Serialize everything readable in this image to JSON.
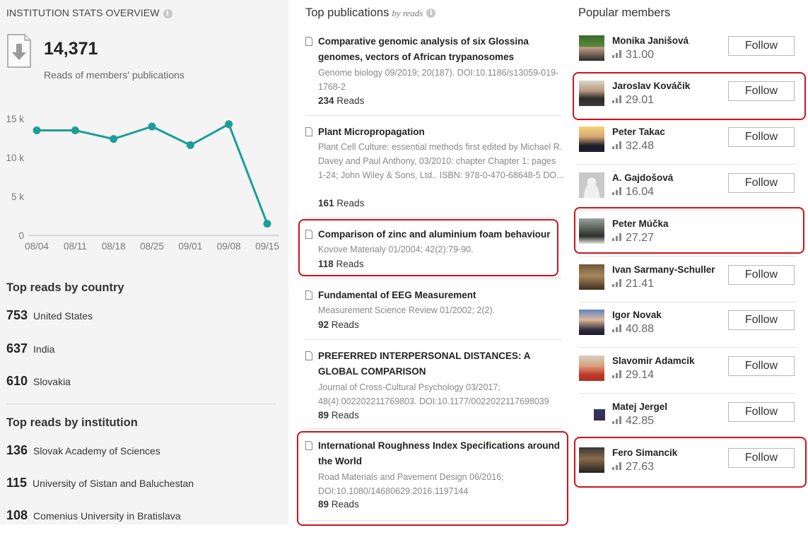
{
  "stats": {
    "title": "INSTITUTION STATS OVERVIEW",
    "info_icon": "info-icon",
    "total_reads": "14,371",
    "reads_caption": "Reads of members' publications"
  },
  "chart_data": {
    "type": "line",
    "categories": [
      "08/04",
      "08/11",
      "08/18",
      "08/25",
      "09/01",
      "09/08",
      "09/15"
    ],
    "values": [
      13500,
      13500,
      12400,
      14000,
      11600,
      14300,
      1500
    ],
    "y_ticks": [
      "0",
      "5 k",
      "10 k",
      "15 k"
    ],
    "ylim": [
      0,
      15000
    ],
    "color": "#1a9e98",
    "grid": false
  },
  "countries": {
    "title": "Top reads by country",
    "items": [
      {
        "count": "753",
        "label": "United States"
      },
      {
        "count": "637",
        "label": "India"
      },
      {
        "count": "610",
        "label": "Slovakia"
      }
    ]
  },
  "institutions": {
    "title": "Top reads by institution",
    "items": [
      {
        "count": "136",
        "label": "Slovak Academy of Sciences"
      },
      {
        "count": "115",
        "label": "University of Sistan and Baluchestan"
      },
      {
        "count": "108",
        "label": "Comenius University in Bratislava"
      }
    ]
  },
  "publications": {
    "title": "Top publications",
    "subtitle": "by reads",
    "reads_word": "Reads",
    "items": [
      {
        "title": "Comparative genomic analysis of six Glossina genomes, vectors of African trypanosomes",
        "meta": "Genome biology 09/2019; 20(187). DOI:10.1186/s13059-019-1768-2",
        "reads": "234"
      },
      {
        "title": "Plant Micropropagation",
        "meta": "Plant Cell Culture: essential methods first edited by Michael R. Davey and Paul Anthony, 03/2010: chapter Chapter 1: pages 1-24; John Wiley & Sons, Ltd.. ISBN: 978-0-470-68648-5 DO...",
        "reads": "161"
      },
      {
        "title": "Comparison of zinc and aluminium foam behaviour",
        "meta": "Kovove Materialy 01/2004; 42(2):79-90.",
        "reads": "118"
      },
      {
        "title": "Fundamental of EEG Measurement",
        "meta": "Measurement Science Review 01/2002; 2(2).",
        "reads": "92"
      },
      {
        "title": "PREFERRED INTERPERSONAL DISTANCES: A GLOBAL COMPARISON",
        "meta": "Journal of Cross-Cultural Psychology 03/2017; 48(4):002202211769803. DOI:10.1177/0022022117698039",
        "reads": "89"
      },
      {
        "title": "International Roughness Index Specifications around the World",
        "meta": "Road Materials and Pavement Design 06/2016; DOI:10.1080/14680629.2016.1197144",
        "reads": "89"
      }
    ]
  },
  "members": {
    "title": "Popular members",
    "follow_label": "Follow",
    "items": [
      {
        "name": "Monika Janišová",
        "score": "31.00"
      },
      {
        "name": "Jaroslav Kováčik",
        "score": "29.01"
      },
      {
        "name": "Peter Takac",
        "score": "32.48"
      },
      {
        "name": "A. Gajdošová",
        "score": "16.04"
      },
      {
        "name": "Peter Múčka",
        "score": "27.27"
      },
      {
        "name": "Ivan Sarmany-Schuller",
        "score": "21.41"
      },
      {
        "name": "Igor Novak",
        "score": "40.88"
      },
      {
        "name": "Slavomir Adamcik",
        "score": "29.14"
      },
      {
        "name": "Matej Jergel",
        "score": "42.85"
      },
      {
        "name": "Fero Simancik",
        "score": "27.63"
      }
    ]
  },
  "highlight_color": "#d0121b"
}
